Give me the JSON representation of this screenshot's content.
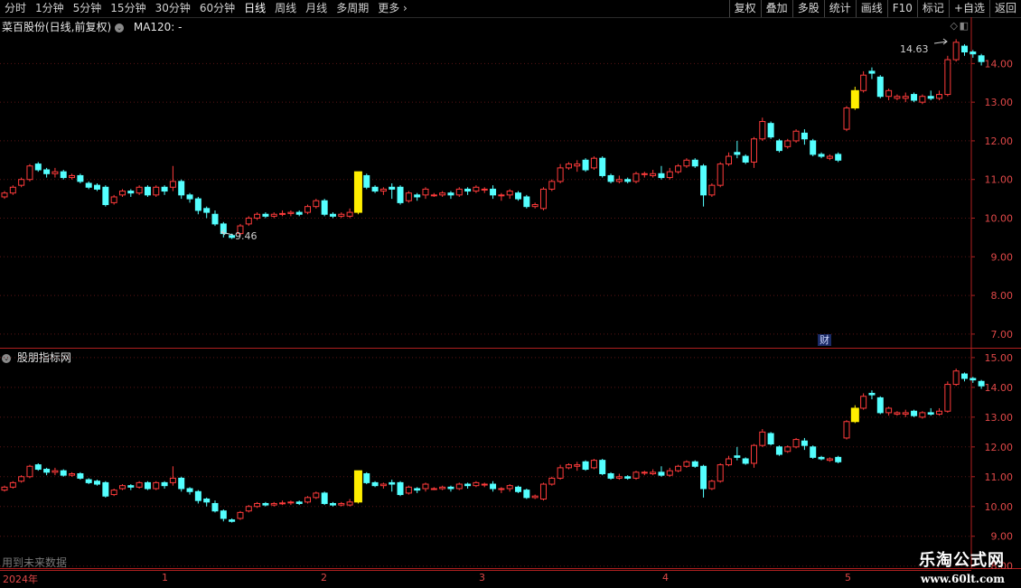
{
  "toolbar": {
    "periods": [
      "分时",
      "1分钟",
      "5分钟",
      "15分钟",
      "30分钟",
      "60分钟",
      "日线",
      "周线",
      "月线",
      "多周期",
      "更多 ›"
    ],
    "active": "日线",
    "buttons": [
      "复权",
      "叠加",
      "多股",
      "统计",
      "画线",
      "F10",
      "标记",
      "+自选",
      "返回"
    ]
  },
  "main_panel": {
    "stock_name": "菜百股份(日线,前复权)",
    "ma_label": "MA120: -",
    "high_note": "14.63",
    "low_note": "9.46",
    "finance_badge": "财"
  },
  "indicator_panel": {
    "title": "股朋指标网",
    "future_note": "用到未来数据"
  },
  "watermark": {
    "title": "乐淘公式网",
    "url": "www.60lt.com"
  },
  "date_axis": {
    "year": "2024年",
    "months": [
      "1",
      "2",
      "3",
      "4",
      "5"
    ]
  },
  "colors": {
    "up": "#ff3b3b",
    "down": "#54ffff",
    "signal": "#ffee00",
    "axis": "#e04848",
    "grid": "#5a1515"
  },
  "chart_data": [
    {
      "type": "candlestick",
      "title": "菜百股份(日线,前复权)",
      "ylim": [
        6.6,
        15.2
      ],
      "yticks": [
        "14.00",
        "13.00",
        "12.00",
        "11.00",
        "10.00",
        "9.00",
        "8.00",
        "7.00"
      ],
      "series": [
        {
          "values": [
            [
              10.55,
              10.65,
              10.5,
              10.7
            ],
            [
              10.65,
              10.8,
              10.6,
              10.85
            ],
            [
              10.85,
              11.0,
              10.8,
              11.05
            ],
            [
              11.0,
              11.35,
              10.95,
              11.4
            ],
            [
              11.4,
              11.25,
              11.2,
              11.45
            ],
            [
              11.25,
              11.15,
              11.05,
              11.3
            ],
            [
              11.15,
              11.2,
              11.05,
              11.3
            ],
            [
              11.2,
              11.05,
              11.0,
              11.25
            ],
            [
              11.05,
              11.1,
              11.0,
              11.15
            ],
            [
              11.1,
              10.95,
              10.9,
              11.15
            ],
            [
              10.9,
              10.8,
              10.75,
              10.95
            ],
            [
              10.85,
              10.75,
              10.7,
              10.9
            ],
            [
              10.8,
              10.35,
              10.3,
              10.85
            ],
            [
              10.4,
              10.55,
              10.35,
              10.6
            ],
            [
              10.6,
              10.7,
              10.55,
              10.75
            ],
            [
              10.7,
              10.65,
              10.55,
              10.75
            ],
            [
              10.65,
              10.8,
              10.6,
              10.85
            ],
            [
              10.8,
              10.6,
              10.55,
              10.85
            ],
            [
              10.6,
              10.8,
              10.55,
              10.85
            ],
            [
              10.8,
              10.7,
              10.6,
              10.85
            ],
            [
              10.8,
              10.95,
              10.7,
              11.35
            ],
            [
              10.95,
              10.6,
              10.5,
              11.0
            ],
            [
              10.6,
              10.5,
              10.4,
              10.65
            ],
            [
              10.5,
              10.2,
              10.1,
              10.55
            ],
            [
              10.25,
              10.15,
              10.0,
              10.3
            ],
            [
              10.1,
              9.85,
              9.8,
              10.2
            ],
            [
              9.85,
              9.6,
              9.5,
              9.9
            ],
            [
              9.55,
              9.5,
              9.46,
              9.6
            ],
            [
              9.6,
              9.8,
              9.55,
              9.85
            ],
            [
              9.85,
              10.0,
              9.8,
              10.05
            ],
            [
              10.0,
              10.1,
              9.95,
              10.15
            ],
            [
              10.1,
              10.05,
              10.0,
              10.15
            ],
            [
              10.05,
              10.1,
              10.0,
              10.15
            ],
            [
              10.1,
              10.12,
              10.05,
              10.2
            ],
            [
              10.12,
              10.15,
              10.05,
              10.2
            ],
            [
              10.15,
              10.1,
              10.05,
              10.2
            ],
            [
              10.15,
              10.3,
              10.1,
              10.35
            ],
            [
              10.3,
              10.45,
              10.25,
              10.5
            ],
            [
              10.45,
              10.1,
              10.05,
              10.5
            ],
            [
              10.1,
              10.05,
              10.0,
              10.15
            ],
            [
              10.05,
              10.1,
              10.0,
              10.15
            ],
            [
              10.05,
              10.15,
              10.0,
              10.25
            ],
            [
              10.15,
              11.2,
              10.1,
              11.2
            ],
            [
              11.1,
              10.8,
              10.75,
              11.15
            ],
            [
              10.8,
              10.7,
              10.65,
              10.85
            ],
            [
              10.7,
              10.75,
              10.6,
              10.8
            ],
            [
              10.8,
              10.75,
              10.5,
              10.9
            ],
            [
              10.8,
              10.4,
              10.35,
              10.85
            ],
            [
              10.45,
              10.65,
              10.4,
              10.7
            ],
            [
              10.6,
              10.55,
              10.45,
              10.65
            ],
            [
              10.6,
              10.75,
              10.5,
              10.8
            ],
            [
              10.6,
              10.6,
              10.55,
              10.65
            ],
            [
              10.6,
              10.65,
              10.55,
              10.7
            ],
            [
              10.65,
              10.6,
              10.5,
              10.7
            ],
            [
              10.6,
              10.75,
              10.55,
              10.8
            ],
            [
              10.75,
              10.7,
              10.6,
              10.8
            ],
            [
              10.7,
              10.8,
              10.65,
              10.85
            ],
            [
              10.75,
              10.75,
              10.65,
              10.8
            ],
            [
              10.75,
              10.6,
              10.5,
              10.85
            ],
            [
              10.6,
              10.6,
              10.45,
              10.65
            ],
            [
              10.6,
              10.7,
              10.5,
              10.75
            ],
            [
              10.65,
              10.5,
              10.45,
              10.7
            ],
            [
              10.55,
              10.3,
              10.25,
              10.6
            ],
            [
              10.3,
              10.35,
              10.25,
              10.4
            ],
            [
              10.25,
              10.75,
              10.2,
              10.8
            ],
            [
              10.75,
              10.95,
              10.7,
              11.0
            ],
            [
              10.95,
              11.3,
              10.9,
              11.4
            ],
            [
              11.3,
              11.4,
              11.25,
              11.45
            ],
            [
              11.35,
              11.4,
              11.2,
              11.5
            ],
            [
              11.5,
              11.25,
              11.2,
              11.55
            ],
            [
              11.3,
              11.55,
              11.25,
              11.6
            ],
            [
              11.55,
              11.1,
              11.05,
              11.6
            ],
            [
              11.1,
              10.95,
              10.9,
              11.15
            ],
            [
              10.95,
              11.0,
              10.9,
              11.1
            ],
            [
              11.0,
              10.95,
              10.9,
              11.05
            ],
            [
              10.95,
              11.15,
              10.9,
              11.2
            ],
            [
              11.15,
              11.15,
              11.05,
              11.2
            ],
            [
              11.1,
              11.15,
              11.05,
              11.25
            ],
            [
              11.15,
              11.05,
              11.0,
              11.35
            ],
            [
              11.05,
              11.2,
              11.0,
              11.3
            ],
            [
              11.2,
              11.35,
              11.15,
              11.4
            ],
            [
              11.35,
              11.5,
              11.3,
              11.55
            ],
            [
              11.5,
              11.35,
              11.3,
              11.55
            ],
            [
              11.35,
              10.6,
              10.3,
              11.4
            ],
            [
              10.6,
              10.85,
              10.55,
              10.9
            ],
            [
              10.85,
              11.4,
              10.8,
              11.45
            ],
            [
              11.4,
              11.6,
              11.35,
              11.7
            ],
            [
              11.7,
              11.65,
              11.55,
              12.0
            ],
            [
              11.6,
              11.45,
              11.4,
              11.65
            ],
            [
              11.45,
              12.05,
              11.3,
              12.1
            ],
            [
              12.05,
              12.5,
              12.0,
              12.6
            ],
            [
              12.45,
              12.1,
              12.05,
              12.5
            ],
            [
              12.0,
              11.75,
              11.7,
              12.05
            ],
            [
              11.85,
              12.0,
              11.8,
              12.05
            ],
            [
              12.0,
              12.25,
              11.95,
              12.3
            ],
            [
              12.2,
              12.05,
              11.9,
              12.3
            ],
            [
              12.0,
              11.65,
              11.6,
              12.05
            ],
            [
              11.65,
              11.6,
              11.55,
              11.7
            ],
            [
              11.55,
              11.6,
              11.5,
              11.65
            ],
            [
              11.65,
              11.5,
              11.45,
              11.7
            ],
            [
              12.3,
              12.85,
              12.25,
              12.9
            ],
            [
              12.85,
              13.3,
              12.8,
              13.4
            ],
            [
              13.3,
              13.7,
              13.25,
              13.8
            ],
            [
              13.8,
              13.75,
              13.6,
              13.9
            ],
            [
              13.65,
              13.15,
              13.1,
              13.7
            ],
            [
              13.15,
              13.3,
              13.05,
              13.35
            ],
            [
              13.1,
              13.15,
              13.05,
              13.2
            ],
            [
              13.1,
              13.15,
              13.0,
              13.25
            ],
            [
              13.2,
              13.05,
              13.0,
              13.25
            ],
            [
              13.0,
              13.15,
              12.95,
              13.2
            ],
            [
              13.15,
              13.1,
              13.05,
              13.3
            ],
            [
              13.1,
              13.2,
              13.05,
              13.3
            ],
            [
              13.2,
              14.1,
              13.15,
              14.2
            ],
            [
              14.1,
              14.55,
              14.05,
              14.63
            ],
            [
              14.45,
              14.3,
              14.2,
              14.5
            ],
            [
              14.3,
              14.25,
              14.15,
              14.35
            ],
            [
              14.2,
              14.05,
              13.95,
              14.25
            ]
          ]
        }
      ],
      "signal_days": [
        42,
        101
      ],
      "annotations": [
        "14.63",
        "9.46"
      ]
    },
    {
      "type": "candlestick",
      "title": "股朋指标网",
      "ylim": [
        7.9,
        15.3
      ],
      "yticks": [
        "15.00",
        "14.00",
        "13.00",
        "12.00",
        "11.00",
        "10.00",
        "9.00",
        "8.00"
      ]
    }
  ]
}
